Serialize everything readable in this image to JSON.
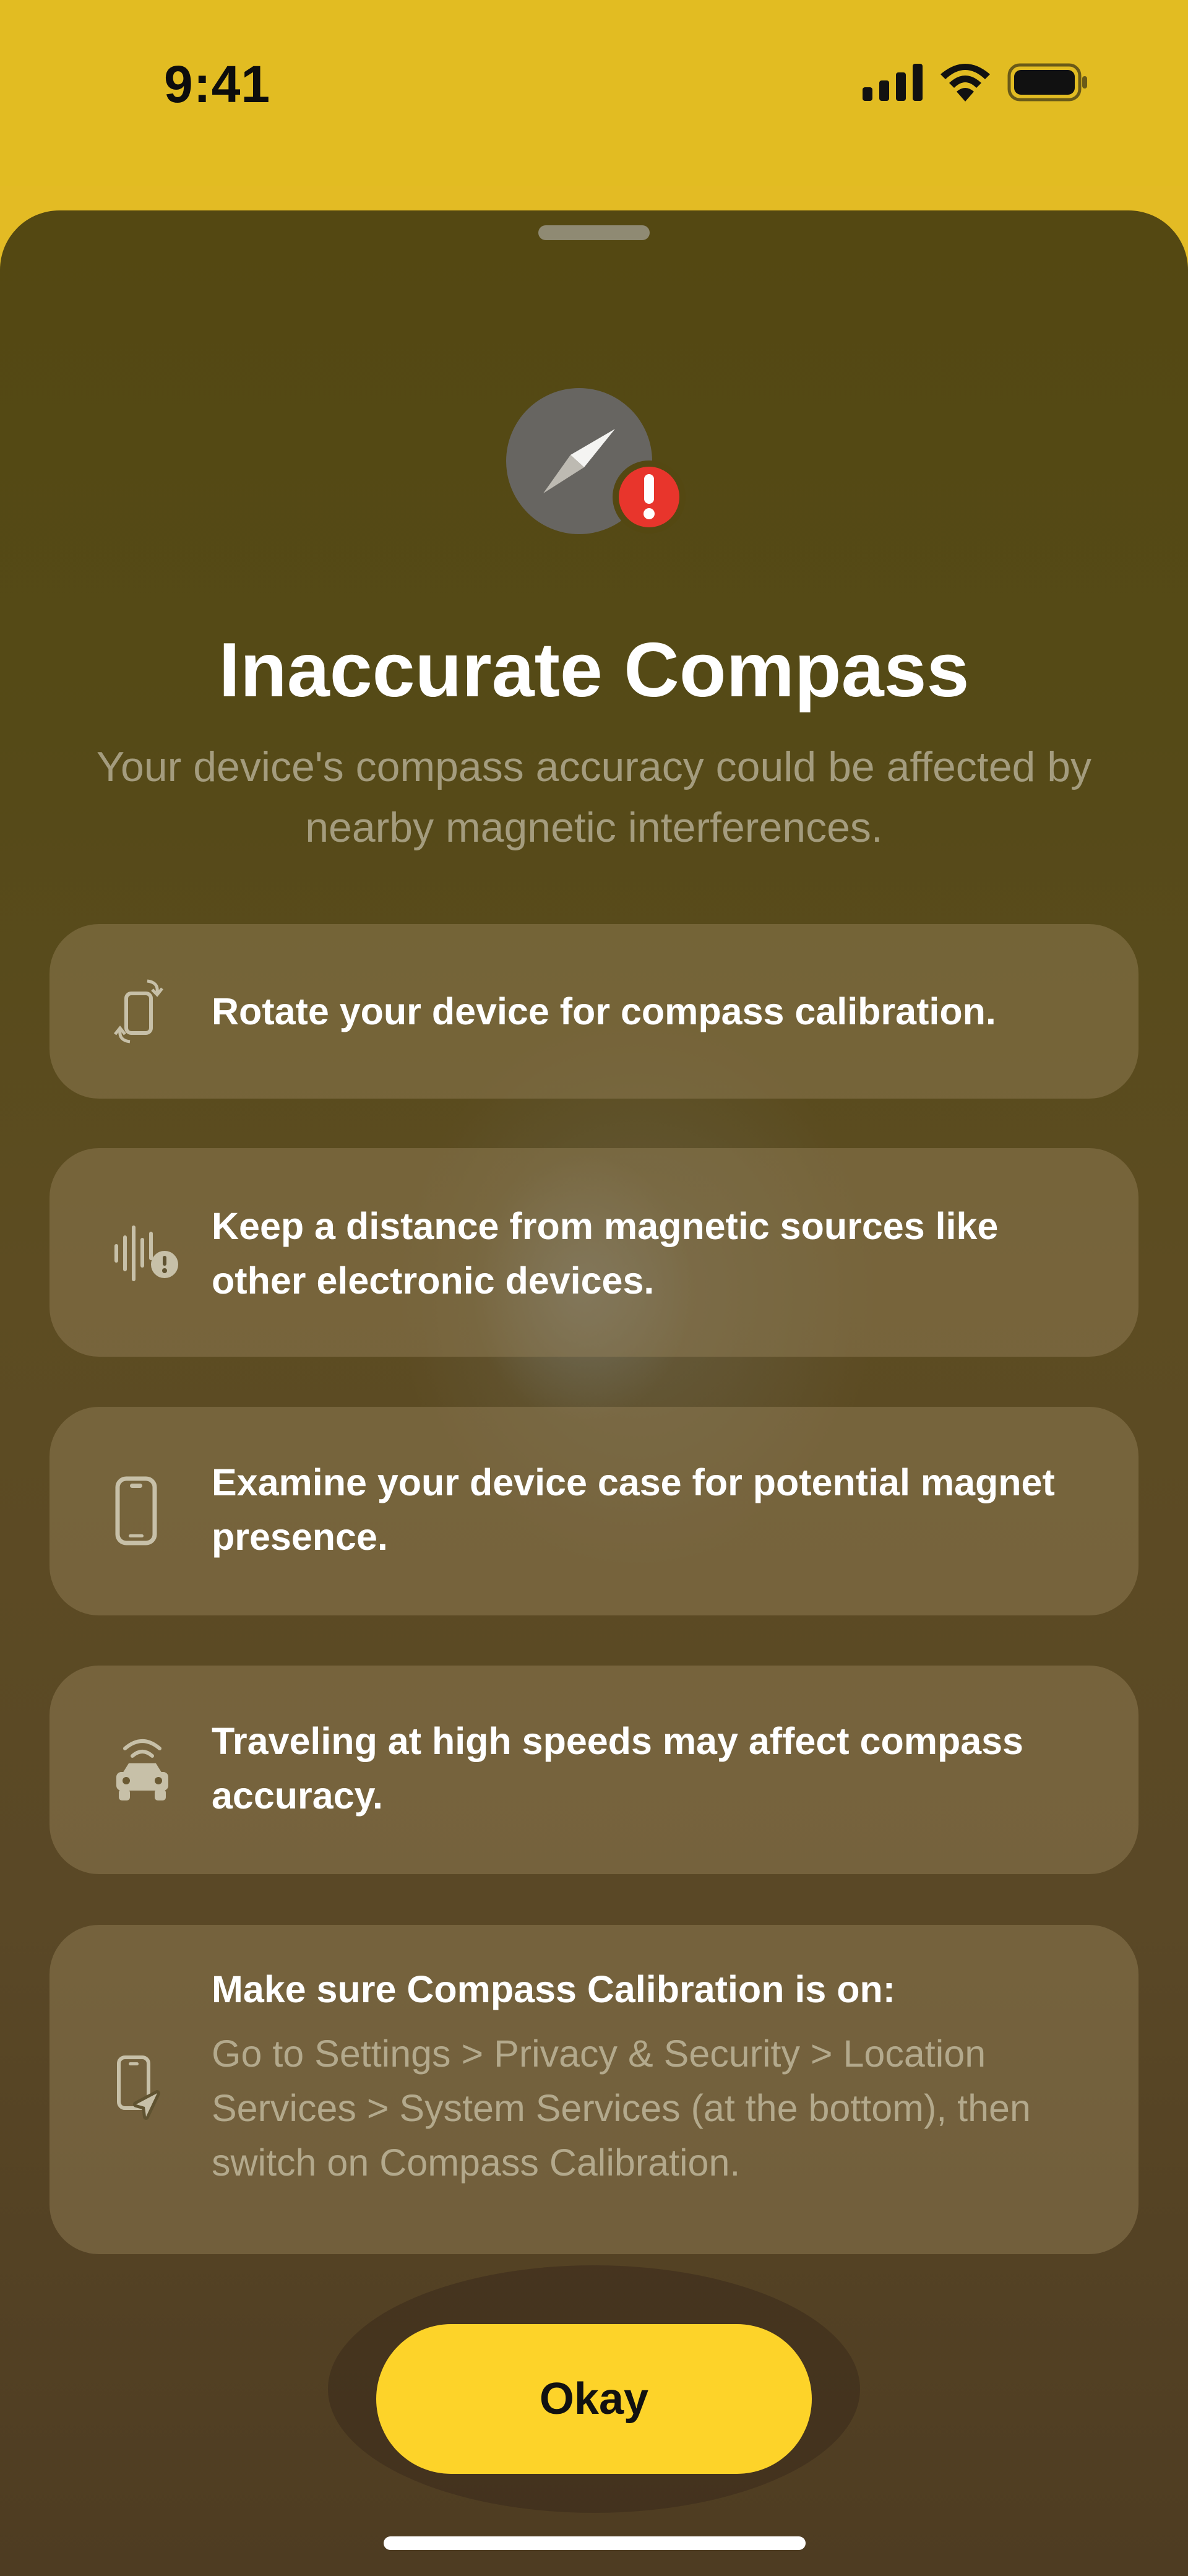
{
  "status_bar": {
    "time": "9:41",
    "icons": [
      "cellular-signal-icon",
      "wifi-icon",
      "battery-icon"
    ]
  },
  "sheet": {
    "icon": "compass-icon",
    "badge_icon": "exclamation-icon",
    "title": "Inaccurate Compass",
    "subtitle": "Your device's compass accuracy could be affected by nearby magnetic interferences."
  },
  "tips": [
    {
      "icon": "rotate-device-icon",
      "text": "Rotate your device for compass calibration."
    },
    {
      "icon": "magnetic-interference-icon",
      "text": "Keep a distance from magnetic sources like other electronic devices."
    },
    {
      "icon": "phone-case-icon",
      "text": "Examine your device case for potential magnet presence."
    },
    {
      "icon": "car-speed-icon",
      "text": "Traveling at high speeds may affect compass accuracy."
    },
    {
      "icon": "location-phone-icon",
      "text": "Make sure Compass Calibration is on:",
      "detail": "Go to Settings > Privacy & Security > Location Services > System Services (at the bottom), then switch on Compass Calibration."
    }
  ],
  "okay_button": {
    "label": "Okay"
  },
  "colors": {
    "accent": "#fdd329",
    "status_bar_bg": "#e2bc22",
    "alert": "#e8352c"
  }
}
